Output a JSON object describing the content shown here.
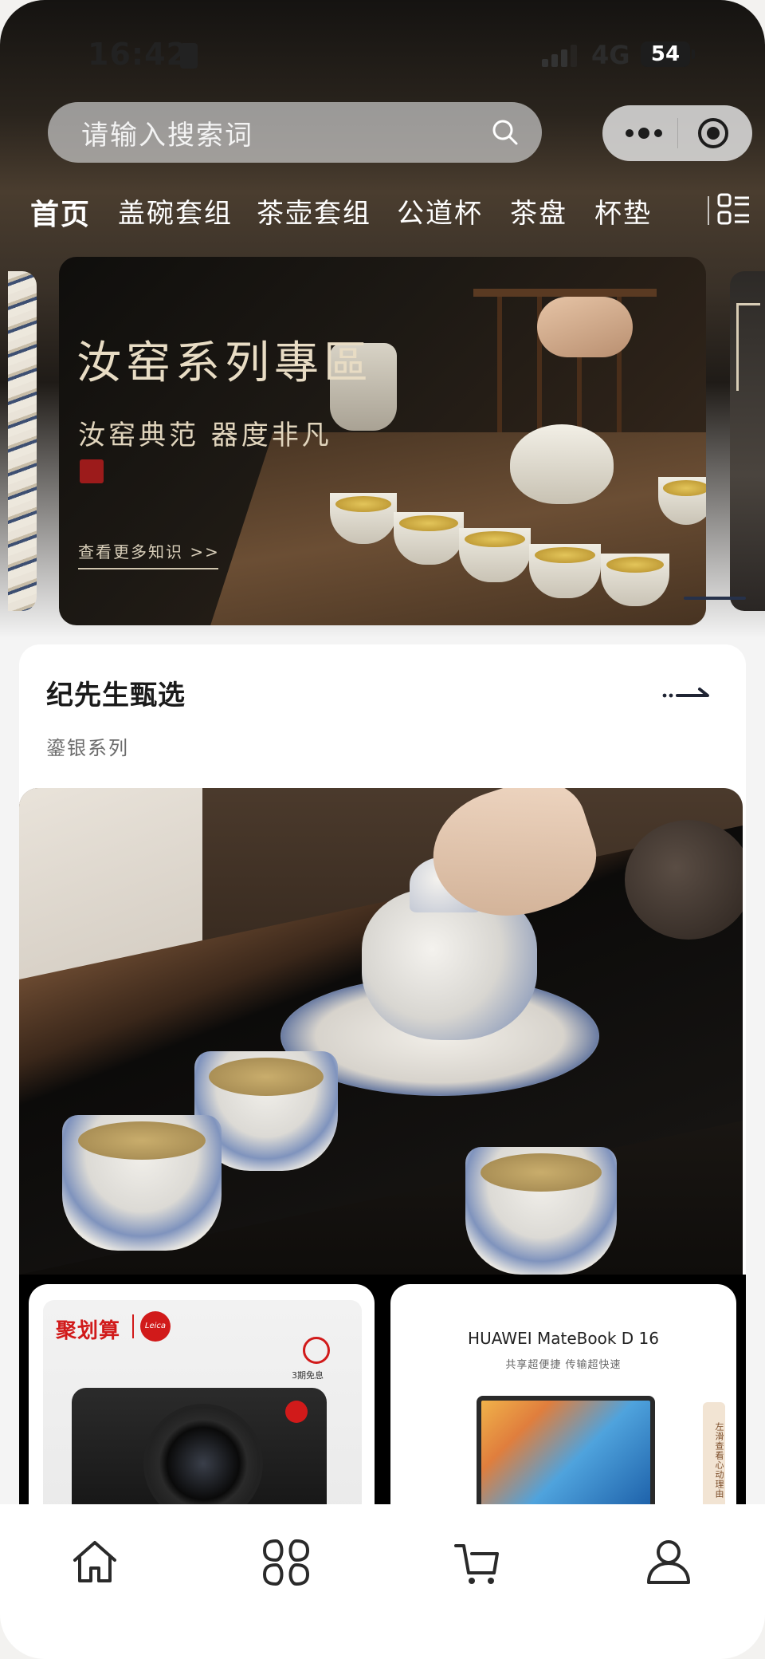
{
  "status_bar": {
    "time": "16:42",
    "network": "4G",
    "battery": "54"
  },
  "search": {
    "placeholder": "请输入搜索词"
  },
  "tabs": [
    {
      "label": "首页",
      "active": true
    },
    {
      "label": "盖碗套组",
      "active": false
    },
    {
      "label": "茶壶套组",
      "active": false
    },
    {
      "label": "公道杯",
      "active": false
    },
    {
      "label": "茶盘",
      "active": false
    },
    {
      "label": "杯垫",
      "active": false
    }
  ],
  "banner": {
    "title": "汝窑系列專區",
    "subtitle": "汝窑典范 器度非凡",
    "link": "查看更多知识 >>"
  },
  "selection": {
    "title": "纪先生甄选",
    "subtitle": "鎏银系列"
  },
  "products": [
    {
      "brand": "聚划算",
      "logo": "Leica",
      "badge": "3期免息"
    },
    {
      "title": "HUAWEI MateBook D 16",
      "subtitle": "共享超便捷 传输超快速",
      "tag": "左滑查看心动理由"
    }
  ],
  "bottom_nav": [
    {
      "icon": "home-icon"
    },
    {
      "icon": "category-icon"
    },
    {
      "icon": "cart-icon"
    },
    {
      "icon": "user-icon"
    }
  ],
  "colors": {
    "accent_red": "#d11a1a",
    "nav_indicator": "#26314a",
    "tab_text": "#ffffff",
    "title_text": "#1b1b1b"
  }
}
